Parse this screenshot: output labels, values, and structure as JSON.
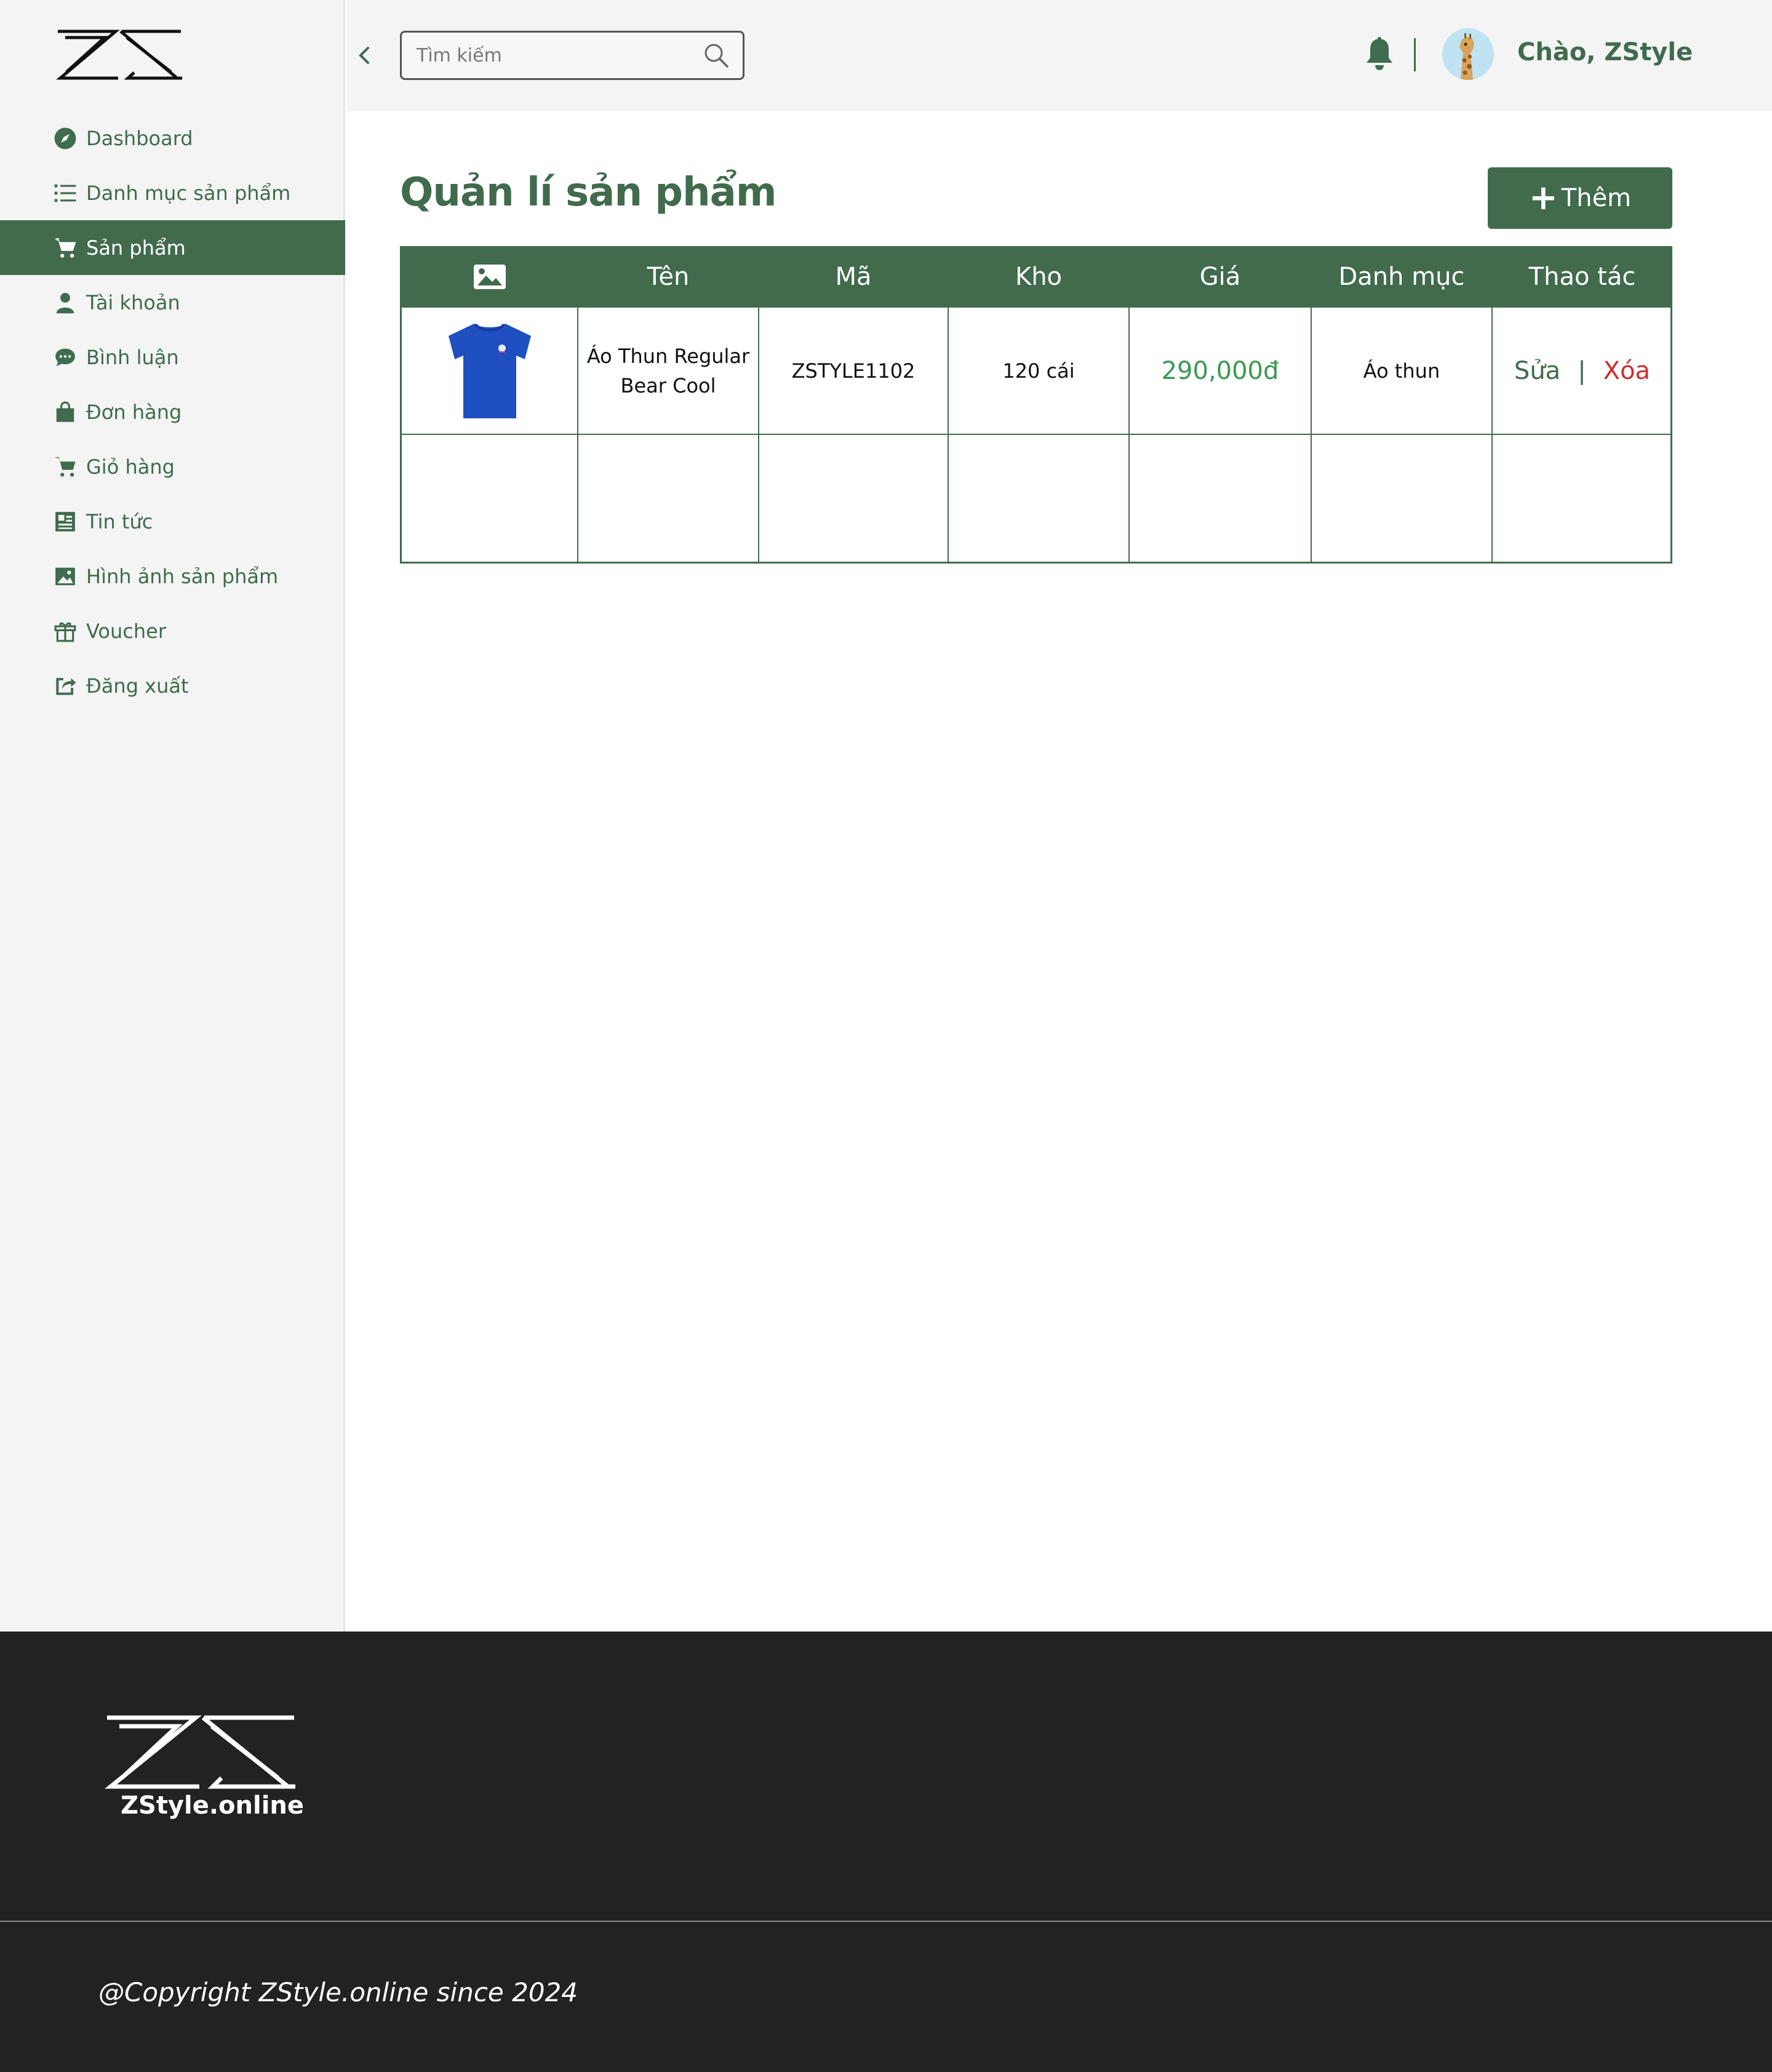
{
  "brand": {
    "logo_text": "ZS"
  },
  "sidebar": {
    "items": [
      {
        "label": "Dashboard",
        "icon": "compass-icon"
      },
      {
        "label": "Danh mục sản phẩm",
        "icon": "list-icon"
      },
      {
        "label": "Sản phẩm",
        "icon": "cart-icon",
        "active": true
      },
      {
        "label": "Tài khoản",
        "icon": "user-icon"
      },
      {
        "label": "Bình luận",
        "icon": "comment-icon"
      },
      {
        "label": "Đơn hàng",
        "icon": "shopping-bag-icon"
      },
      {
        "label": "Giỏ hàng",
        "icon": "cart-icon"
      },
      {
        "label": "Tin tức",
        "icon": "newspaper-icon"
      },
      {
        "label": "Hình ảnh sản phẩm",
        "icon": "image-icon"
      },
      {
        "label": "Voucher",
        "icon": "gift-icon"
      },
      {
        "label": "Đăng xuất",
        "icon": "logout-icon"
      }
    ]
  },
  "header": {
    "search_placeholder": "Tìm kiếm",
    "greeting": "Chào, ZStyle"
  },
  "main": {
    "title": "Quản lí sản phẩm",
    "add_label": "Thêm",
    "columns": [
      "Tên",
      "Mã",
      "Kho",
      "Giá",
      "Danh mục",
      "Thao tác"
    ],
    "rows": [
      {
        "name_line1": "Áo Thun Regular",
        "name_line2": "Bear Cool",
        "code": "ZSTYLE1102",
        "stock": "120 cái",
        "price": "290,000đ",
        "category": "Áo thun",
        "edit_label": "Sửa",
        "separator": "|",
        "delete_label": "Xóa"
      }
    ]
  },
  "footer": {
    "brand": "ZStyle.online",
    "copyright": "@Copyright ZStyle.online since 2024"
  },
  "colors": {
    "primary": "#416b4c",
    "price": "#3a9a4f",
    "delete": "#c9302c",
    "footer_bg": "#222222",
    "sidebar_bg": "#f4f4f4"
  }
}
